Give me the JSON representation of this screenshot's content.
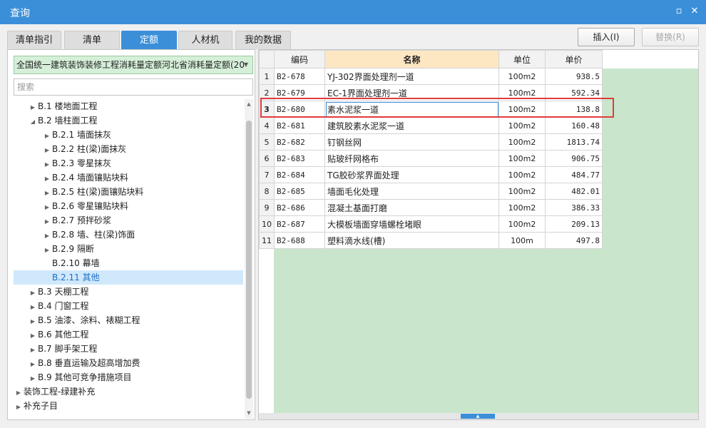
{
  "window": {
    "title": "查询",
    "restore_glyph": "▫",
    "close_glyph": "✕"
  },
  "tabs": [
    {
      "label": "清单指引",
      "active": false
    },
    {
      "label": "清单",
      "active": false
    },
    {
      "label": "定额",
      "active": true
    },
    {
      "label": "人材机",
      "active": false
    },
    {
      "label": "我的数据",
      "active": false
    }
  ],
  "actions": {
    "insert_label": "插入(I)",
    "replace_label": "替换(R)"
  },
  "left": {
    "combo_value": "全国统一建筑装饰装修工程消耗量定额河北省消耗量定额(20",
    "combo_arrow": "▼",
    "search_placeholder": "搜索",
    "tree": [
      {
        "label": "B.1 楼地面工程",
        "level": 1,
        "toggle": "▶",
        "selected": false
      },
      {
        "label": "B.2 墙柱面工程",
        "level": 1,
        "toggle": "◢",
        "selected": false
      },
      {
        "label": "B.2.1 墙面抹灰",
        "level": 2,
        "toggle": "▶",
        "selected": false
      },
      {
        "label": "B.2.2 柱(梁)面抹灰",
        "level": 2,
        "toggle": "▶",
        "selected": false
      },
      {
        "label": "B.2.3 零星抹灰",
        "level": 2,
        "toggle": "▶",
        "selected": false
      },
      {
        "label": "B.2.4 墙面镶贴块料",
        "level": 2,
        "toggle": "▶",
        "selected": false
      },
      {
        "label": "B.2.5 柱(梁)面镶贴块料",
        "level": 2,
        "toggle": "▶",
        "selected": false
      },
      {
        "label": "B.2.6 零星镶贴块料",
        "level": 2,
        "toggle": "▶",
        "selected": false
      },
      {
        "label": "B.2.7 预拌砂浆",
        "level": 2,
        "toggle": "▶",
        "selected": false
      },
      {
        "label": "B.2.8 墙、柱(梁)饰面",
        "level": 2,
        "toggle": "▶",
        "selected": false
      },
      {
        "label": "B.2.9 隔断",
        "level": 2,
        "toggle": "▶",
        "selected": false
      },
      {
        "label": "B.2.10 幕墙",
        "level": 2,
        "toggle": "",
        "selected": false
      },
      {
        "label": "B.2.11 其他",
        "level": 2,
        "toggle": "",
        "selected": true
      },
      {
        "label": "B.3 天棚工程",
        "level": 1,
        "toggle": "▶",
        "selected": false
      },
      {
        "label": "B.4 门窗工程",
        "level": 1,
        "toggle": "▶",
        "selected": false
      },
      {
        "label": "B.5 油漆、涂料、裱糊工程",
        "level": 1,
        "toggle": "▶",
        "selected": false
      },
      {
        "label": "B.6 其他工程",
        "level": 1,
        "toggle": "▶",
        "selected": false
      },
      {
        "label": "B.7 脚手架工程",
        "level": 1,
        "toggle": "▶",
        "selected": false
      },
      {
        "label": "B.8 垂直运输及超高增加费",
        "level": 1,
        "toggle": "▶",
        "selected": false
      },
      {
        "label": "B.9 其他可竞争措施项目",
        "level": 1,
        "toggle": "▶",
        "selected": false
      },
      {
        "label": "装饰工程-绿建补充",
        "level": 0,
        "toggle": "▶",
        "selected": false
      },
      {
        "label": "补充子目",
        "level": 0,
        "toggle": "▶",
        "selected": false
      }
    ]
  },
  "grid": {
    "columns": [
      "编码",
      "名称",
      "单位",
      "单价"
    ],
    "current_row": 3,
    "rows": [
      {
        "idx": "1",
        "code": "B2-678",
        "name": "YJ-302界面处理剂一道",
        "unit": "100m2",
        "price": "938.5"
      },
      {
        "idx": "2",
        "code": "B2-679",
        "name": "EC-1界面处理剂一道",
        "unit": "100m2",
        "price": "592.34"
      },
      {
        "idx": "3",
        "code": "B2-680",
        "name": "素水泥浆一道",
        "unit": "100m2",
        "price": "138.8"
      },
      {
        "idx": "4",
        "code": "B2-681",
        "name": "建筑胶素水泥浆一道",
        "unit": "100m2",
        "price": "160.48"
      },
      {
        "idx": "5",
        "code": "B2-682",
        "name": "钉钢丝网",
        "unit": "100m2",
        "price": "1813.74"
      },
      {
        "idx": "6",
        "code": "B2-683",
        "name": "贴玻纤网格布",
        "unit": "100m2",
        "price": "906.75"
      },
      {
        "idx": "7",
        "code": "B2-684",
        "name": "TG胶砂浆界面处理",
        "unit": "100m2",
        "price": "484.77"
      },
      {
        "idx": "8",
        "code": "B2-685",
        "name": "墙面毛化处理",
        "unit": "100m2",
        "price": "482.01"
      },
      {
        "idx": "9",
        "code": "B2-686",
        "name": "混凝土基面打磨",
        "unit": "100m2",
        "price": "386.33"
      },
      {
        "idx": "10",
        "code": "B2-687",
        "name": "大模板墙面穿墙螺栓堵眼",
        "unit": "100m2",
        "price": "209.13"
      },
      {
        "idx": "11",
        "code": "B2-688",
        "name": "塑料滴水线(槽)",
        "unit": "100m",
        "price": "497.8"
      }
    ]
  },
  "scrollbar": {
    "up_glyph": "▲",
    "down_glyph": "▼",
    "handle_glyph": "▲"
  }
}
